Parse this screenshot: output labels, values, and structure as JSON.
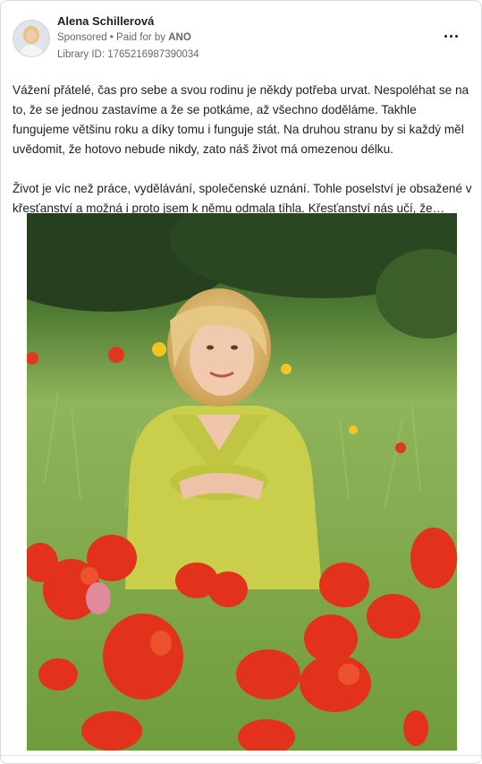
{
  "post": {
    "author": "Alena Schillerová",
    "sponsored": "Sponsored",
    "paid_prefix": " • Paid for by ",
    "paid_by": "ANO",
    "library_id": "Library ID: 1765216987390034",
    "paragraph1": "Vážení přátelé, čas pro sebe a svou rodinu je někdy potřeba urvat. Nespoléhat se na to, že se jednou zastavíme a že se potkáme, až všechno doděláme. Takhle fungujeme většinu roku a díky tomu i funguje stát. Na druhou stranu by si každý měl uvědomit, že hotovo nebude nikdy, zato náš život má omezenou délku.",
    "paragraph2": "Život je víc než práce, vydělávání, společenské uznání. Tohle poselství je obsažené v křesťanství a možná i proto jsem k němu odmala tíhla. Křesťanství nás učí, že…",
    "more_icon": "more-horizontal-icon",
    "image_subject": "woman-in-tulip-field"
  },
  "colors": {
    "text": "#1c1e21",
    "secondary": "#65676b",
    "border": "#d8dadf",
    "tulip_red": "#e0371f",
    "jacket": "#c9cf4a",
    "grass": "#7fa84a"
  }
}
